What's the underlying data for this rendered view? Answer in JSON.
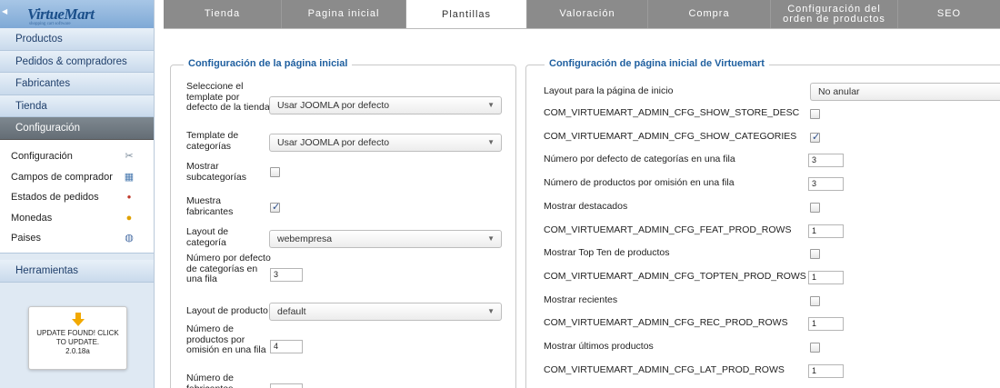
{
  "logo": {
    "text": "VirtueMart",
    "tagline": "shopping cart software"
  },
  "sidebar": {
    "main_items": [
      {
        "label": "Productos"
      },
      {
        "label": "Pedidos & compradores"
      },
      {
        "label": "Fabricantes"
      },
      {
        "label": "Tienda"
      },
      {
        "label": "Configuración",
        "active": true
      }
    ],
    "sub_items": [
      {
        "label": "Configuración",
        "icon": "tools-icon"
      },
      {
        "label": "Campos de comprador",
        "icon": "form-icon"
      },
      {
        "label": "Estados de pedidos",
        "icon": "status-icon"
      },
      {
        "label": "Monedas",
        "icon": "coins-icon"
      },
      {
        "label": "Paises",
        "icon": "globe-icon"
      }
    ],
    "tools_item": "Herramientas",
    "update_box": {
      "line1": "UPDATE FOUND! CLICK",
      "line2": "TO UPDATE.",
      "line3": "2.0.18a"
    }
  },
  "tabs": [
    {
      "label": "Tienda"
    },
    {
      "label": "Pagina inicial"
    },
    {
      "label": "Plantillas",
      "active": true
    },
    {
      "label": "Valoración"
    },
    {
      "label": "Compra"
    },
    {
      "label": "Configuración del orden de productos"
    },
    {
      "label": "SEO"
    }
  ],
  "left_panel": {
    "legend": "Configuración de la página inicial",
    "template_label": "Seleccione el template por defecto de la tienda",
    "template_value": "Usar JOOMLA por defecto",
    "category_template_label": "Template de categorías",
    "category_template_value": "Usar JOOMLA por defecto",
    "show_subcategories_label": "Mostrar subcategorías",
    "show_manufacturers_label": "Muestra fabricantes",
    "category_layout_label": "Layout de categoría",
    "category_layout_value": "webempresa",
    "categories_per_row_label": "Número por defecto de categorías en una fila",
    "categories_per_row_value": "3",
    "product_layout_label": "Layout de producto",
    "product_layout_value": "default",
    "products_per_row_label": "Número de productos por omisión en una fila",
    "products_per_row_value": "4",
    "manufacturers_label": "Número de fabricantes"
  },
  "right_panel": {
    "legend": "Configuración de página inicial de Virtuemart",
    "layout_label": "Layout para la página de inicio",
    "layout_value": "No anular",
    "rows": [
      {
        "label": "COM_VIRTUEMART_ADMIN_CFG_SHOW_STORE_DESC",
        "type": "check",
        "checked": false
      },
      {
        "label": "COM_VIRTUEMART_ADMIN_CFG_SHOW_CATEGORIES",
        "type": "check",
        "checked": true
      },
      {
        "label": "Número por defecto de categorías en una fila",
        "type": "input",
        "value": "3"
      },
      {
        "label": "Número de productos por omisión en una fila",
        "type": "input",
        "value": "3"
      },
      {
        "label": "Mostrar destacados",
        "type": "check",
        "checked": false
      },
      {
        "label": "COM_VIRTUEMART_ADMIN_CFG_FEAT_PROD_ROWS",
        "type": "input",
        "value": "1"
      },
      {
        "label": "Mostrar Top Ten de productos",
        "type": "check",
        "checked": false
      },
      {
        "label": "COM_VIRTUEMART_ADMIN_CFG_TOPTEN_PROD_ROWS",
        "type": "input",
        "value": "1"
      },
      {
        "label": "Mostrar recientes",
        "type": "check",
        "checked": false
      },
      {
        "label": "COM_VIRTUEMART_ADMIN_CFG_REC_PROD_ROWS",
        "type": "input",
        "value": "1"
      },
      {
        "label": "Mostrar últimos productos",
        "type": "check",
        "checked": false
      },
      {
        "label": "COM_VIRTUEMART_ADMIN_CFG_LAT_PROD_ROWS",
        "type": "input",
        "value": "1"
      }
    ]
  }
}
